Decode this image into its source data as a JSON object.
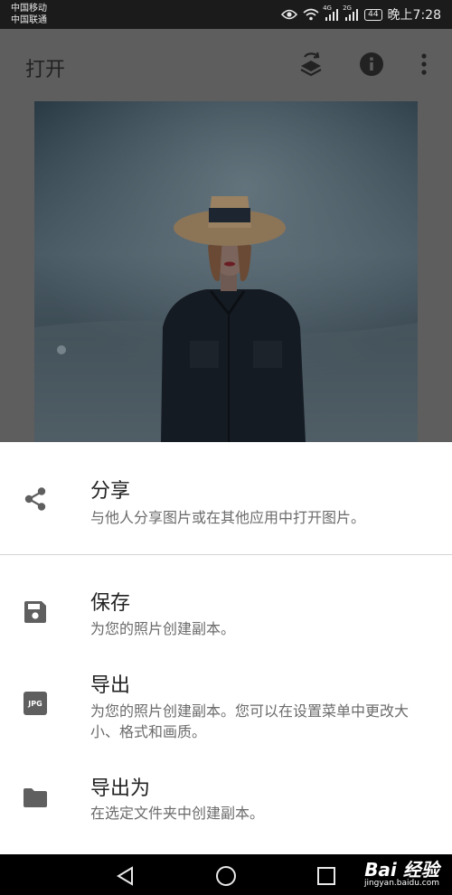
{
  "status_bar": {
    "carrier_1": "中国移动",
    "carrier_2": "中国联通",
    "signal_1_label": "4G",
    "signal_2_label": "2G",
    "battery": "44",
    "time": "晚上7:28",
    "icons": [
      "eye-icon",
      "wifi-icon",
      "signal-icon",
      "signal-icon",
      "battery-icon"
    ]
  },
  "app_bar": {
    "title": "打开",
    "icons": [
      "layers-icon",
      "info-icon",
      "more-vert-icon"
    ]
  },
  "sheet": {
    "share": {
      "title": "分享",
      "description": "与他人分享图片或在其他应用中打开图片。",
      "icon": "share-icon"
    },
    "save": {
      "title": "保存",
      "description": "为您的照片创建副本。",
      "icon": "save-icon"
    },
    "export": {
      "title": "导出",
      "description": "为您的照片创建副本。您可以在设置菜单中更改大小、格式和画质。",
      "icon": "jpg-icon",
      "icon_text": "JPG"
    },
    "export_as": {
      "title": "导出为",
      "description": "在选定文件夹中创建副本。",
      "icon": "folder-icon"
    }
  },
  "nav_bar": {
    "icons": [
      "back-icon",
      "home-icon",
      "recents-icon"
    ]
  },
  "watermark": {
    "brand": "Bai  经验",
    "url": "jingyan.baidu.com"
  },
  "colors": {
    "dim_background": "#5e5e5e",
    "sheet": "#ffffff",
    "icon": "#5f5f5f",
    "text_primary": "#222222",
    "text_secondary": "#6b6b6b"
  }
}
